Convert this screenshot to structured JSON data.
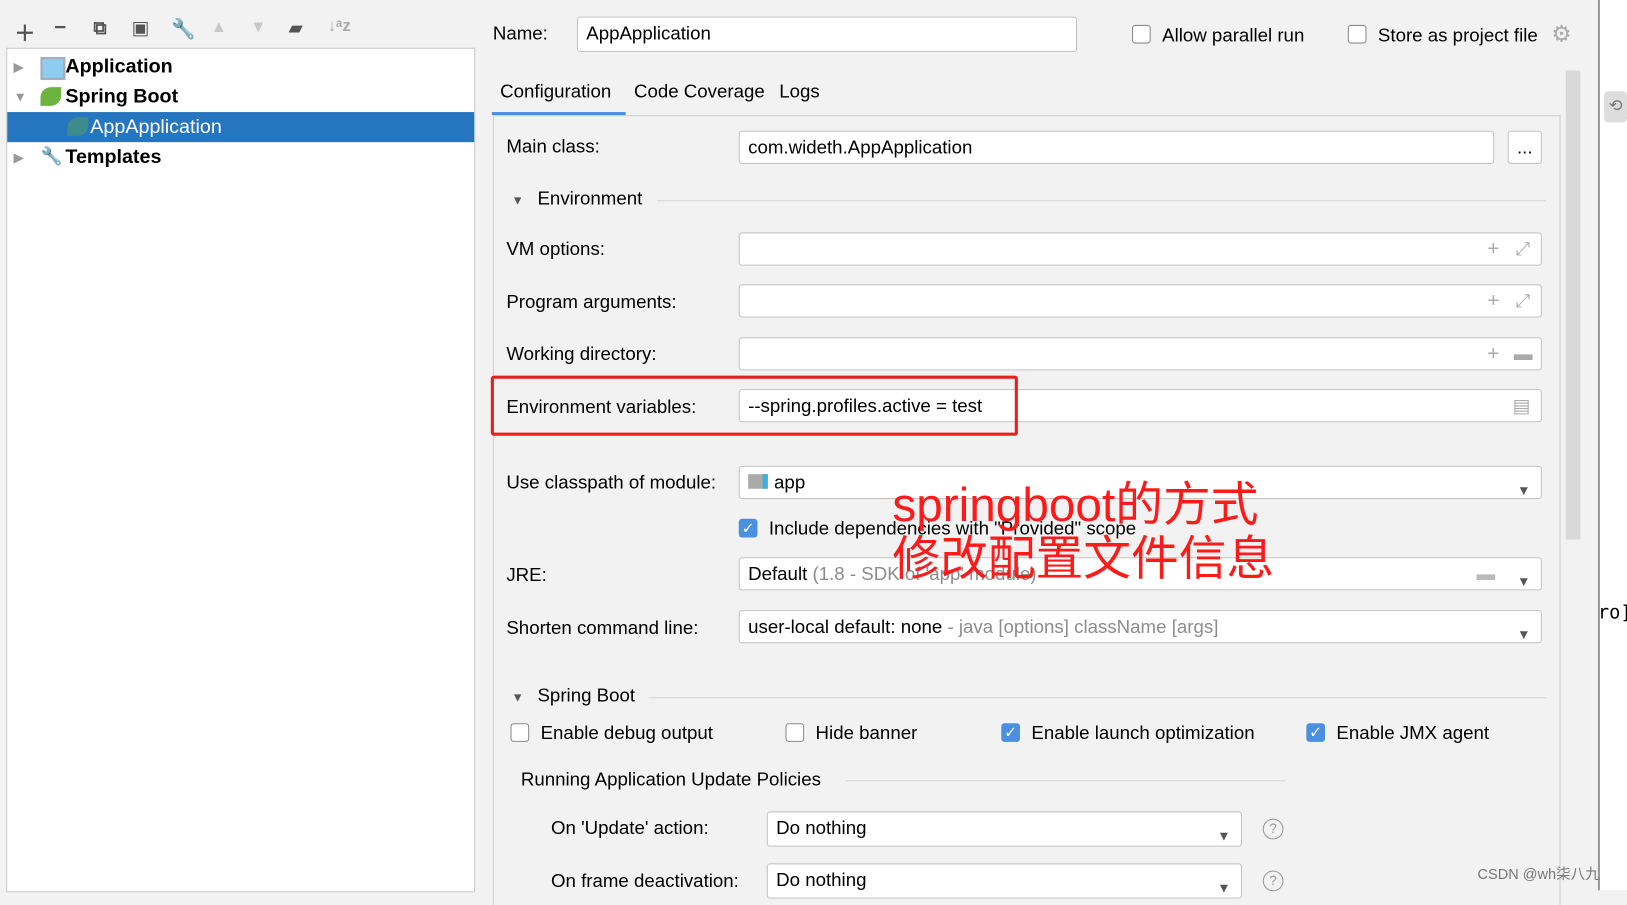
{
  "toolbar": {
    "icons": [
      "plus-icon",
      "minus-icon",
      "copy-icon",
      "save-icon",
      "wrench-icon",
      "arrow-up-icon",
      "arrow-down-icon",
      "new-folder-icon",
      "sort-icon"
    ]
  },
  "tree": [
    {
      "label": "Application",
      "expanded": false,
      "icon": "application-icon"
    },
    {
      "label": "Spring Boot",
      "expanded": true,
      "icon": "spring-boot-icon"
    },
    {
      "label": "AppApplication",
      "selected": true,
      "icon": "spring-boot-icon"
    },
    {
      "label": "Templates",
      "expanded": false,
      "icon": "wrench-icon"
    }
  ],
  "header": {
    "name_label": "Name:",
    "name_value": "AppApplication",
    "allow_parallel": "Allow parallel run",
    "allow_parallel_checked": false,
    "store_project": "Store as project file",
    "store_project_checked": false
  },
  "tabs": [
    "Configuration",
    "Code Coverage",
    "Logs"
  ],
  "active_tab": "Configuration",
  "form": {
    "main_class_label": "Main class:",
    "main_class": "com.wideth.AppApplication",
    "browse": "...",
    "environment_section": "Environment",
    "vm_options_label": "VM options:",
    "program_args_label": "Program arguments:",
    "working_dir_label": "Working directory:",
    "env_vars_label": "Environment variables:",
    "env_vars": "--spring.profiles.active = test",
    "classpath_label": "Use classpath of module:",
    "classpath": "app",
    "include_deps": "Include dependencies with \"Provided\" scope",
    "include_deps_checked": true,
    "jre_label": "JRE:",
    "jre_value": "Default",
    "jre_hint": "(1.8 - SDK of 'app' module)",
    "shorten_label": "Shorten command line:",
    "shorten_value": "user-local default: none",
    "shorten_hint": "- java [options] className [args]"
  },
  "spring": {
    "section": "Spring Boot",
    "options": [
      {
        "label": "Enable debug output",
        "checked": false
      },
      {
        "label": "Hide banner",
        "checked": false
      },
      {
        "label": "Enable launch optimization",
        "checked": true
      },
      {
        "label": "Enable JMX agent",
        "checked": true
      }
    ],
    "policies_title": "Running Application Update Policies",
    "update_label": "On 'Update' action:",
    "update_value": "Do nothing",
    "frame_label": "On frame deactivation:",
    "frame_value": "Do nothing"
  },
  "annotation": {
    "line1": "springboot的方式",
    "line2": "修改配置文件信息",
    "color": "#ff0000"
  },
  "watermark": "CSDN @wh柒八九",
  "side_text": "ro]"
}
